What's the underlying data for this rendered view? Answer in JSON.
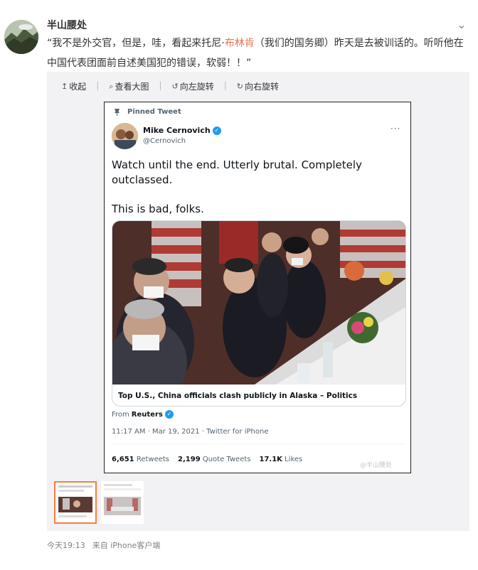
{
  "post": {
    "username": "半山腰处",
    "text_before": "“我不是外交官，但是，哇，看起来托尼·",
    "mention": "布林肯",
    "text_after": "（我们的国务卿）昨天是去被训话的。听听他在中国代表团面前自述美国犯的错误，软弱！！”",
    "more_icon": "chevron-down-icon",
    "timestamp": "今天19:13",
    "source": "来自 iPhone客户端"
  },
  "toolbar": {
    "collapse": "收起",
    "view_large": "查看大图",
    "rotate_left": "向左旋转",
    "rotate_right": "向右旋转"
  },
  "tweet": {
    "pinned_label": "Pinned Tweet",
    "name": "Mike Cernovich",
    "handle": "@Cernovich",
    "body_line1": "Watch until the end. Utterly brutal. Completely outclassed.",
    "body_line2": "This is bad, folks.",
    "card_title": "Top U.S., China officials clash publicly in Alaska – Politics",
    "from_label": "From",
    "from_source": "Reuters",
    "meta": "11:17 AM · Mar 19, 2021 · Twitter for iPhone",
    "retweets_count": "6,651",
    "retweets_label": "Retweets",
    "quote_count": "2,199",
    "quote_label": "Quote Tweets",
    "likes_count": "17.1K",
    "likes_label": "Likes",
    "watermark": "@半山腰处"
  },
  "colors": {
    "mention": "#eb7350",
    "twitter_blue": "#1d9bf0",
    "active_thumb": "#fa7d3c",
    "panel_bg": "#f2f2f5"
  }
}
